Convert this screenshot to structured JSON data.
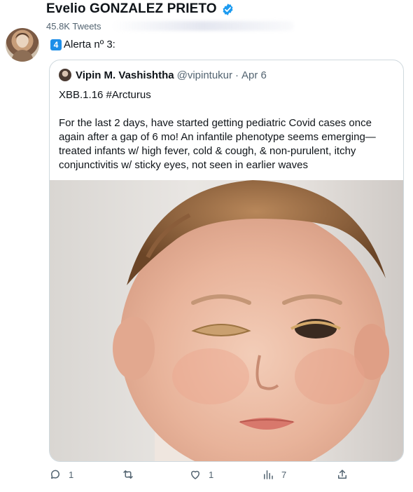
{
  "profile": {
    "display_name": "Evelio GONZALEZ PRIETO",
    "tweet_count": "45.8K Tweets"
  },
  "tweet": {
    "keycap": "4",
    "text": "Alerta nº 3:"
  },
  "quoted": {
    "name": "Vipin M. Vashishtha",
    "handle": "@vipintukur",
    "dot": "·",
    "date": "Apr 6",
    "line1": "XBB.1.16 #Arcturus",
    "line2": "For the last 2 days, have started getting pediatric Covid cases once again after a gap of 6 mo! An infantile phenotype seems emerging—treated infants w/ high fever, cold & cough, & non-purulent, itchy conjunctivitis w/ sticky eyes, not seen in earlier waves"
  },
  "actions": {
    "reply_count": "1",
    "retweet_count": "",
    "like_count": "1",
    "views_count": "7"
  },
  "colors": {
    "accent": "#1d9bf0",
    "muted": "#536471",
    "border": "#cfd9de"
  }
}
